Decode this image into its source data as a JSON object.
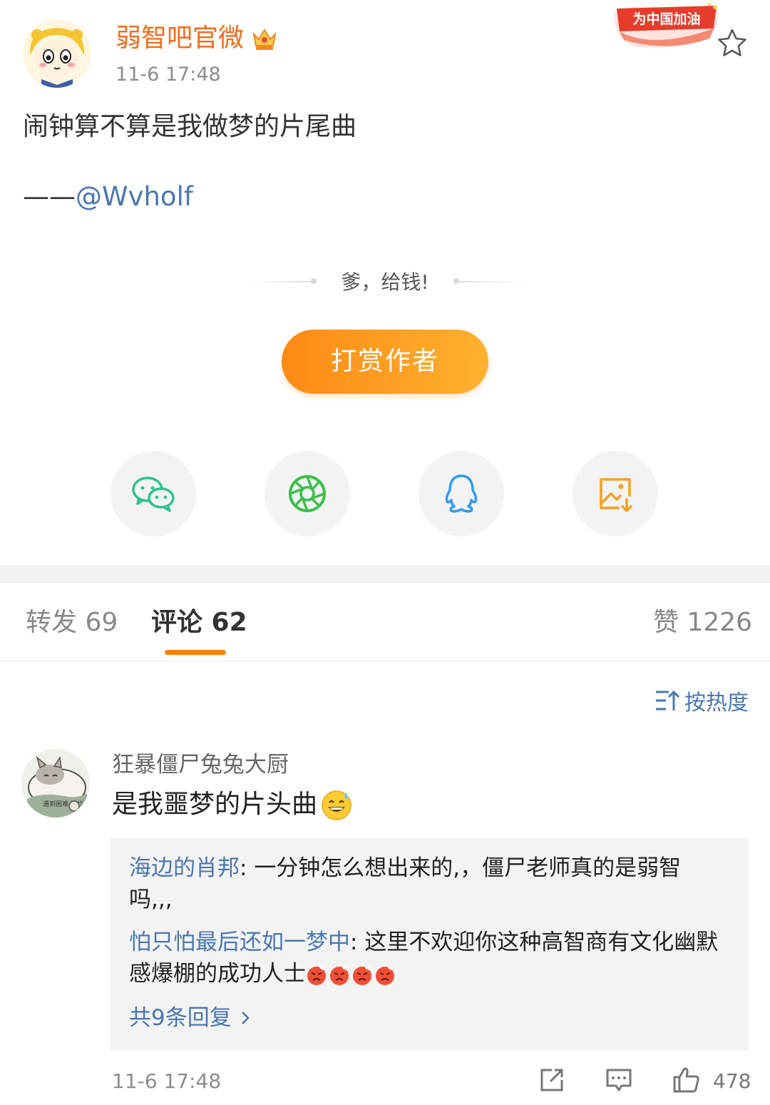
{
  "post": {
    "author": "弱智吧官微",
    "time": "11-6 17:48",
    "campaign_badge": "为中国加油",
    "text": "闹钟算不算是我做梦的片尾曲",
    "credit_dash": "——",
    "credit_mention": "@Wvholf"
  },
  "reward": {
    "slogan": "爹，给钱!",
    "button": "打赏作者"
  },
  "share": {
    "items": [
      "wechat-icon",
      "moments-icon",
      "qq-icon",
      "save-image-icon"
    ]
  },
  "tabs": {
    "repost": "转发 69",
    "comments": "评论 62",
    "likes": "赞 1226"
  },
  "sort": {
    "label": "按热度"
  },
  "comment": {
    "name": "狂暴僵尸兔兔大厨",
    "text": "是我噩梦的片头曲",
    "avatar_text": "遇到困难 摆烂",
    "time": "11-6 17:48",
    "like_count": "478",
    "replies": [
      {
        "name": "海边的肖邦",
        "sep": ": ",
        "text": "一分钟怎么想出来的,，僵尸老师真的是弱智吗,,,"
      },
      {
        "name": "怕只怕最后还如一梦中",
        "sep": ": ",
        "text": "这里不欢迎你这种高智商有文化幽默感爆棚的成功人士"
      }
    ],
    "more_replies": "共9条回复"
  },
  "colors": {
    "accent_orange": "#ff8200",
    "author_orange": "#f26c1c",
    "link_blue": "#4a77b0"
  }
}
